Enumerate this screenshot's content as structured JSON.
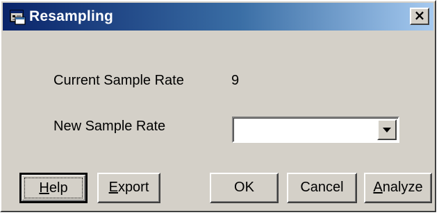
{
  "window": {
    "title": "Resampling",
    "close_glyph": "×"
  },
  "fields": {
    "current_rate_label": "Current Sample Rate",
    "current_rate_value": "9",
    "new_rate_label": "New Sample Rate",
    "new_rate_value": ""
  },
  "buttons": {
    "help": {
      "mnemonic": "H",
      "rest": "elp"
    },
    "export": {
      "mnemonic": "E",
      "rest": "xport"
    },
    "ok": "OK",
    "cancel": "Cancel",
    "analyze": {
      "mnemonic": "A",
      "rest": "nalyze"
    }
  },
  "icons": {
    "app": "dialog-app-icon",
    "dropdown": "chevron-down-icon"
  },
  "colors": {
    "face": "#d4d0c8",
    "title_start": "#0a246a",
    "title_end": "#a6caf0"
  }
}
